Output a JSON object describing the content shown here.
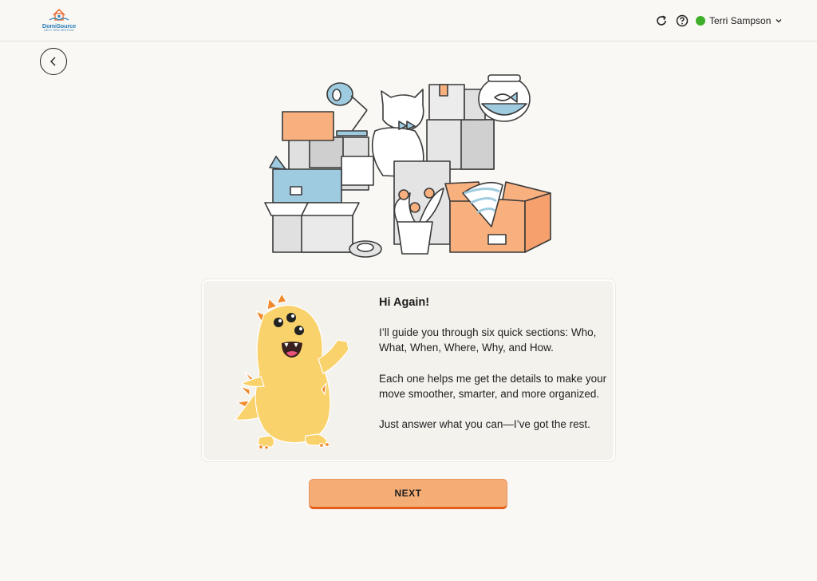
{
  "header": {
    "logo_text": "DomiSource",
    "logo_tagline": "NEXT GEN NESTING",
    "user_name": "Terri Sampson",
    "status_color": "#3fae2a",
    "icons": [
      "refresh-icon",
      "help-icon",
      "chevron-down-icon"
    ]
  },
  "nav": {
    "back_icon": "chevron-left-icon"
  },
  "card": {
    "title": "Hi Again!",
    "paragraph_1": "I’ll guide you through six quick sections: Who, What, When, Where, Why, and How.",
    "paragraph_2": "Each one helps me get the details to make your move smoother, smarter, and more organized.",
    "paragraph_3": "Just answer what you can—I’ve got the rest."
  },
  "actions": {
    "next_label": "NEXT"
  },
  "colors": {
    "background": "#faf8f4",
    "accent": "#f5ad76",
    "accent_border": "#e35f1b",
    "mascot": "#f9d26b",
    "mascot_spikes": "#f08a2c",
    "box_blue": "#9ecbe0",
    "box_orange": "#f9b07f"
  }
}
